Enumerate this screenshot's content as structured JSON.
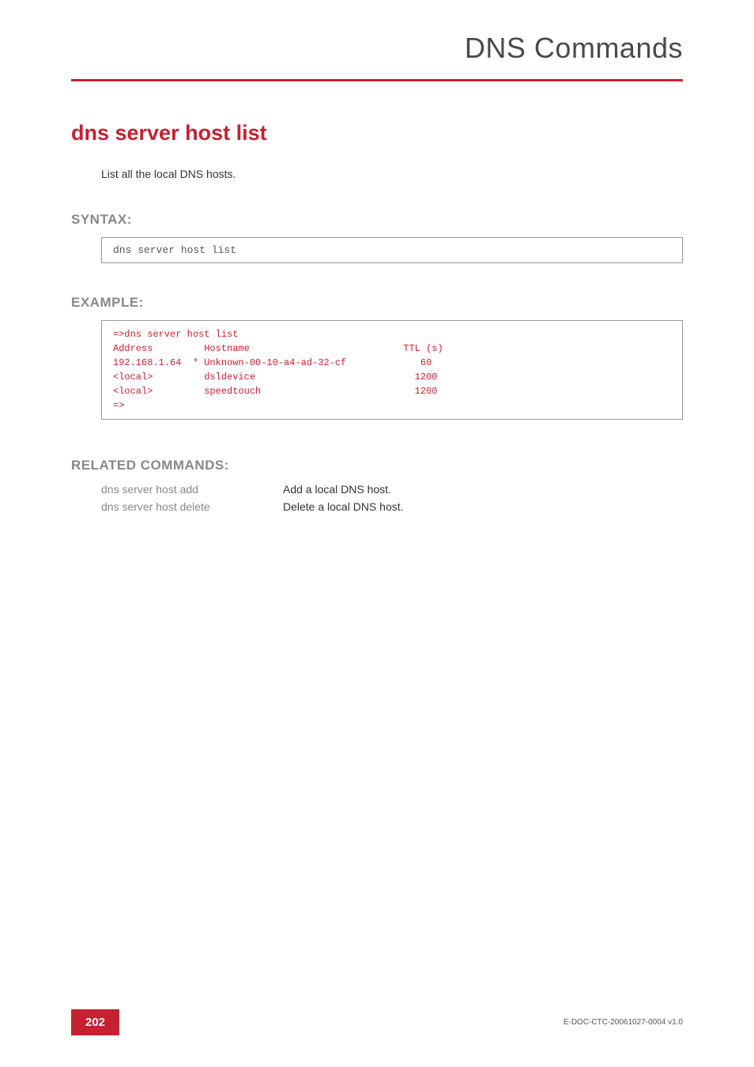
{
  "header": {
    "section_title": "DNS Commands"
  },
  "command": {
    "title": "dns server host list",
    "description": "List all the local DNS hosts."
  },
  "syntax": {
    "label": "SYNTAX:",
    "text": "dns server host list"
  },
  "example": {
    "label": "EXAMPLE:",
    "text": "=>dns server host list\nAddress         Hostname                           TTL (s)\n192.168.1.64  * Unknown-00-10-a4-ad-32-cf             60\n<local>         dsldevice                            1200\n<local>         speedtouch                           1200\n=>"
  },
  "related": {
    "label": "RELATED COMMANDS:",
    "items": [
      {
        "cmd": "dns server host add",
        "desc": "Add a local DNS host."
      },
      {
        "cmd": "dns server host delete",
        "desc": "Delete a local DNS host."
      }
    ]
  },
  "footer": {
    "page_number": "202",
    "doc_id": "E-DOC-CTC-20061027-0004 v1.0"
  }
}
